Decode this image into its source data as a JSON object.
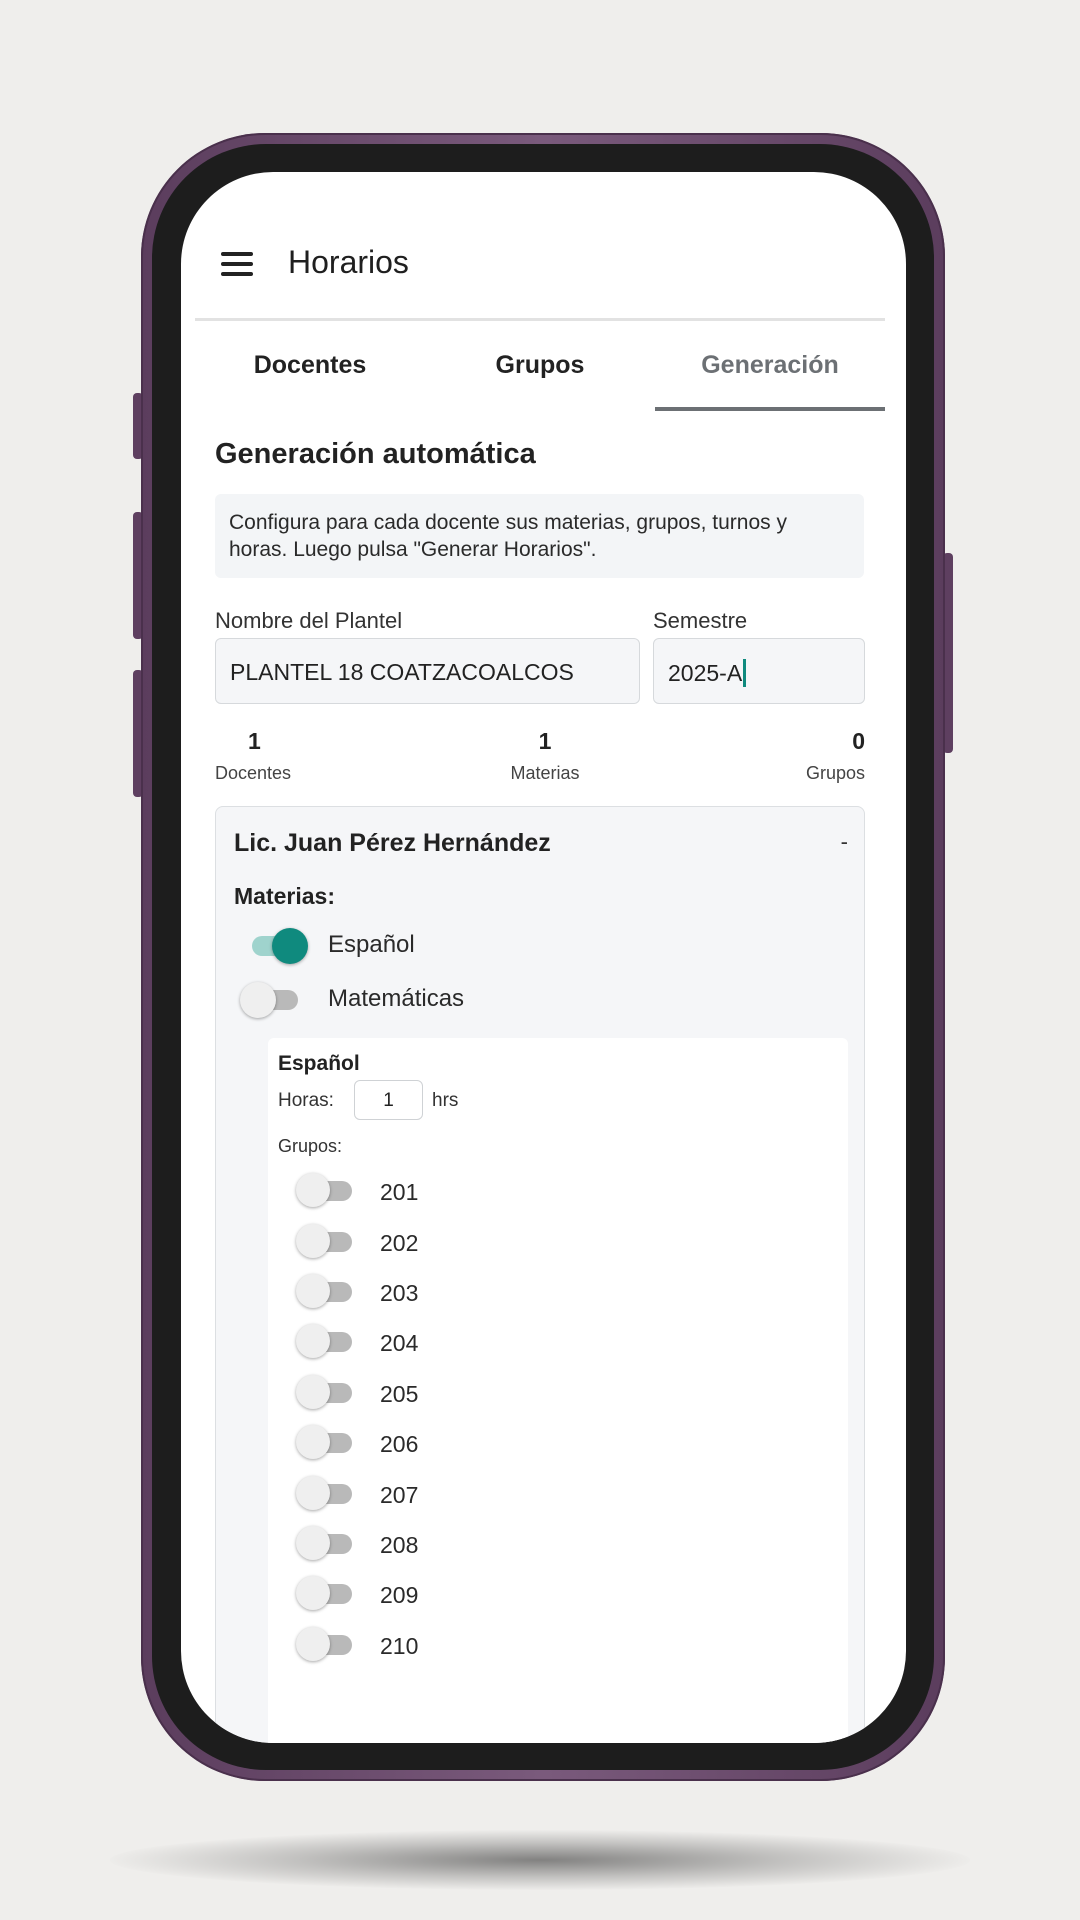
{
  "app": {
    "title": "Horarios"
  },
  "tabs": [
    "Docentes",
    "Grupos",
    "Generación"
  ],
  "active_tab": "Generación",
  "section_title": "Generación automática",
  "info_text": "Configura para cada docente sus materias, grupos, turnos y horas. Luego pulsa \"Generar Horarios\".",
  "form": {
    "plantel_label": "Nombre del Plantel",
    "plantel_value": "PLANTEL 18 COATZACOALCOS",
    "semestre_label": "Semestre",
    "semestre_value": "2025-A"
  },
  "stats": [
    {
      "value": "1",
      "label": "Docentes"
    },
    {
      "value": "1",
      "label": "Materias"
    },
    {
      "value": "0",
      "label": "Grupos"
    }
  ],
  "teacher": {
    "name": "Lic. Juan Pérez Hernández",
    "collapse_symbol": "-",
    "materias_label": "Materias:",
    "materias": [
      {
        "name": "Español",
        "enabled": true
      },
      {
        "name": "Matemáticas",
        "enabled": false
      }
    ],
    "subject_panel": {
      "title": "Español",
      "horas_label": "Horas:",
      "horas_value": "1",
      "horas_unit": "hrs",
      "grupos_label": "Grupos:",
      "grupos": [
        {
          "name": "201",
          "enabled": false
        },
        {
          "name": "202",
          "enabled": false
        },
        {
          "name": "203",
          "enabled": false
        },
        {
          "name": "204",
          "enabled": false
        },
        {
          "name": "205",
          "enabled": false
        },
        {
          "name": "206",
          "enabled": false
        },
        {
          "name": "207",
          "enabled": false
        },
        {
          "name": "208",
          "enabled": false
        },
        {
          "name": "209",
          "enabled": false
        },
        {
          "name": "210",
          "enabled": false
        }
      ]
    }
  },
  "colors": {
    "accent": "#0f8a7e",
    "accent_track": "#9fd3cd",
    "tab_inactive_active": "#6c7074",
    "phone_frame": "#6b4a6d",
    "background": "#efeeec"
  }
}
